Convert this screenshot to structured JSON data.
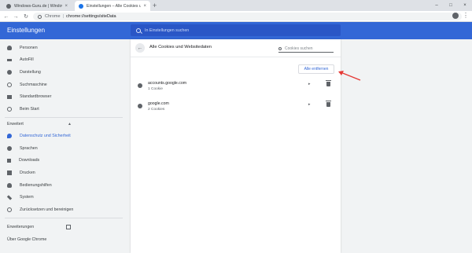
{
  "tabs": [
    {
      "title": "Windows-Guru.de | Windows Tip",
      "favicon_color": "#5f6368"
    },
    {
      "title": "Einstellungen – Alle Cookies und",
      "favicon_color": "#1a73e8"
    }
  ],
  "window_controls": {
    "minimize": "–",
    "maximize": "□",
    "close": "×"
  },
  "toolbar": {
    "scheme_label": "Chrome",
    "separator": "|",
    "url": "chrome://settings/siteData"
  },
  "header": {
    "title": "Einstellungen",
    "search_placeholder": "In Einstellungen suchen"
  },
  "sidebar": {
    "items": [
      {
        "label": "Personen",
        "icon": "person-icon"
      },
      {
        "label": "AutoFill",
        "icon": "autofill-icon"
      },
      {
        "label": "Darstellung",
        "icon": "palette-icon"
      },
      {
        "label": "Suchmaschine",
        "icon": "search-icon"
      },
      {
        "label": "Standardbrowser",
        "icon": "browser-icon"
      },
      {
        "label": "Beim Start",
        "icon": "power-icon"
      }
    ],
    "advanced_label": "Erweitert",
    "advanced_items": [
      {
        "label": "Datenschutz und Sicherheit",
        "icon": "shield-icon",
        "active": true
      },
      {
        "label": "Sprachen",
        "icon": "globe-icon"
      },
      {
        "label": "Downloads",
        "icon": "download-icon"
      },
      {
        "label": "Drucken",
        "icon": "printer-icon"
      },
      {
        "label": "Bedienungshilfen",
        "icon": "accessibility-icon"
      },
      {
        "label": "System",
        "icon": "wrench-icon"
      },
      {
        "label": "Zurücksetzen und bereinigen",
        "icon": "reset-icon"
      }
    ],
    "extensions_label": "Erweiterungen",
    "about_label": "Über Google Chrome"
  },
  "main": {
    "title": "Alle Cookies und Websitedaten",
    "cookie_search_placeholder": "Cookies suchen",
    "remove_all_label": "Alle entfernen",
    "sites": [
      {
        "name": "accounts.google.com",
        "count": "1 Cookie"
      },
      {
        "name": "google.com",
        "count": "2 Cookies"
      }
    ]
  },
  "colors": {
    "accent": "#3367d6",
    "annotation": "#e53935"
  }
}
